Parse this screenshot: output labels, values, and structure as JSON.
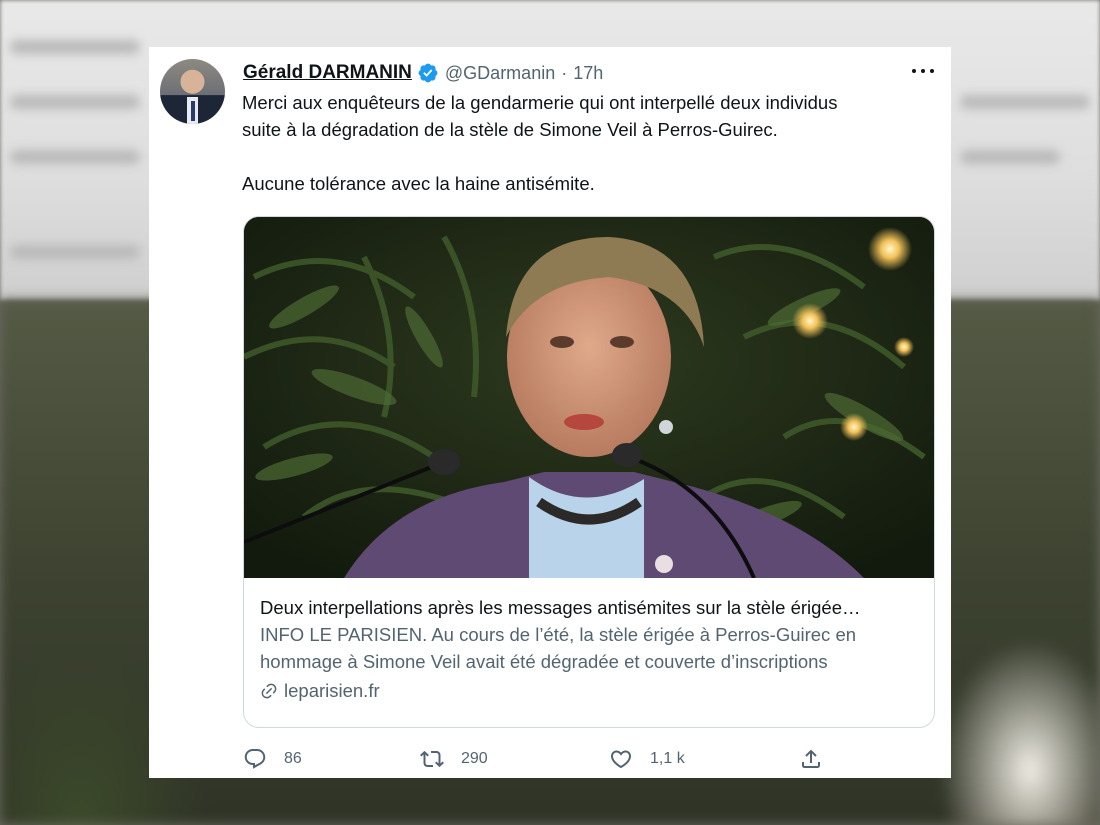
{
  "tweet": {
    "author_name": "Gérald DARMANIN",
    "handle": "@GDarmanin",
    "separator": "·",
    "time": "17h",
    "text_lines": [
      "Merci aux enquêteurs de la gendarmerie qui ont interpellé deux individus",
      "suite à la dégradation de la stèle de Simone Veil à Perros-Guirec.",
      "Aucune tolérance avec la haine antisémite."
    ],
    "verified": true
  },
  "link_card": {
    "title": "Deux interpellations après les messages antisémites sur la stèle érigée…",
    "description_lines": [
      "INFO LE PARISIEN. Au cours de l’été, la stèle érigée à Perros-Guirec en",
      "hommage à Simone Veil avait été dégradée et couverte d’inscriptions"
    ],
    "domain": "leparisien.fr"
  },
  "actions": {
    "reply_count": "86",
    "retweet_count": "290",
    "like_count": "1,1 k"
  },
  "colors": {
    "text_primary": "#0f1419",
    "text_secondary": "#536471",
    "verified_blue": "#1d9bf0",
    "card_border": "#cfd9de"
  },
  "icons": [
    "more-icon",
    "verified-badge-icon",
    "link-icon",
    "reply-icon",
    "retweet-icon",
    "like-icon",
    "share-icon"
  ]
}
